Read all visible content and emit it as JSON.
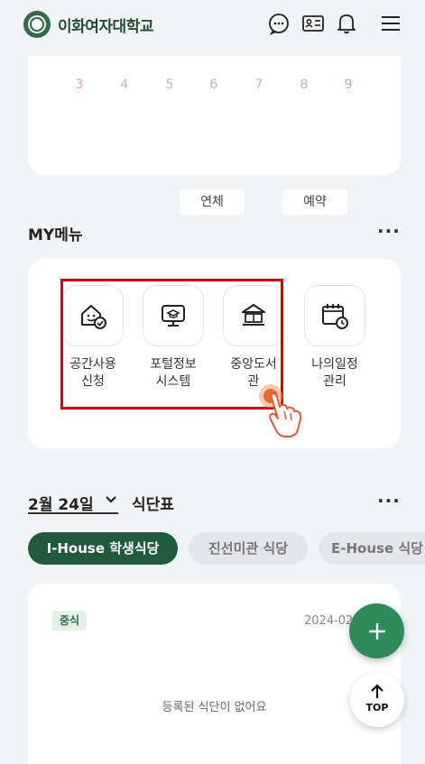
{
  "header": {
    "logo_text": "이화여자대학교",
    "icons": [
      "chat-icon",
      "id-card-icon",
      "bell-icon",
      "menu-icon"
    ]
  },
  "calendar": {
    "days": [
      "3",
      "4",
      "5",
      "6",
      "7",
      "8",
      "9"
    ],
    "buttons": [
      "연체",
      "예약"
    ]
  },
  "my_menu": {
    "title": "MY메뉴",
    "more": "···",
    "items": [
      {
        "label_line1": "공간사용",
        "label_line2": "신청",
        "icon": "space-booking-icon"
      },
      {
        "label_line1": "포털정보",
        "label_line2": "시스템",
        "icon": "portal-monitor-icon"
      },
      {
        "label_line1": "중앙도서",
        "label_line2": "관",
        "icon": "library-icon"
      },
      {
        "label_line1": "나의일정",
        "label_line2": "관리",
        "icon": "calendar-clock-icon"
      }
    ]
  },
  "meal": {
    "date": "2월 24일",
    "title": "식단표",
    "more": "···",
    "tabs": [
      "I-House 학생식당",
      "진선미관 식당",
      "E-House 식당"
    ],
    "badge": "중식",
    "date_label": "2024-02-24",
    "empty_message": "등록된 식단이 없어요"
  },
  "fab": {
    "top_label": "TOP"
  },
  "colors": {
    "brand_green": "#1f5a3c",
    "fab_green": "#2f8a5a",
    "highlight_red": "#e00000"
  }
}
